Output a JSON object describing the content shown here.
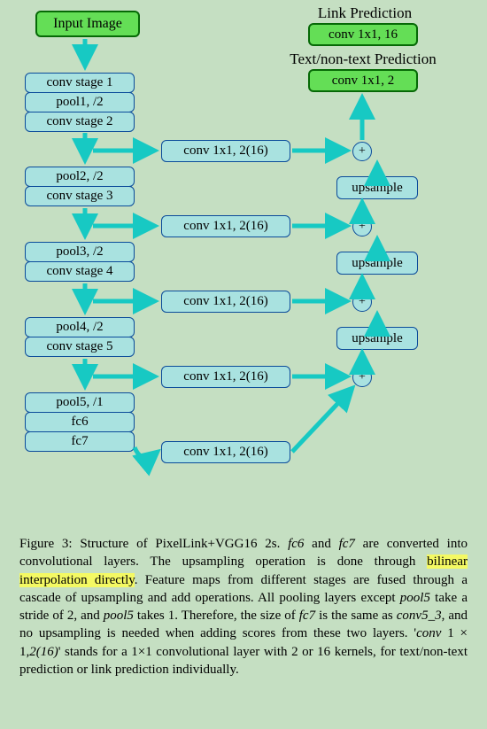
{
  "input": "Input Image",
  "head": {
    "link_title": "Link Prediction",
    "text_title": "Text/non-text Prediction",
    "link_box": "conv 1x1, 16",
    "text_box": "conv 1x1, 2"
  },
  "left": {
    "s12": [
      "conv stage 1",
      "pool1, /2",
      "conv stage 2"
    ],
    "s3": [
      "pool2, /2",
      "conv stage 3"
    ],
    "s4": [
      "pool3, /2",
      "conv stage 4"
    ],
    "s5": [
      "pool4, /2",
      "conv stage 5"
    ],
    "s6": [
      "pool5, /1",
      "fc6",
      "fc7"
    ]
  },
  "mid": {
    "c": "conv 1x1, 2(16)"
  },
  "right": {
    "up": "upsample",
    "plus": "+"
  },
  "caption": {
    "lead": "Figure 3: Structure of PixelLink+VGG16 2s. ",
    "fc6": "fc6",
    "and": " and ",
    "fc7": "fc7",
    "t1": " are converted into convolutional layers. The upsampling operation is done through ",
    "hl": "bilinear interpolation directly",
    "t2": ". Feature maps from different stages are fused through a cascade of upsampling and add operations. All pooling layers except ",
    "p5": "pool5",
    "t3": " take a stride of 2, and ",
    "p5b": "pool5",
    "t4": " takes 1. Therefore, the size of ",
    "fc7b": "fc7",
    "t5": " is the same as ",
    "c53": "conv5_3",
    "t6": ", and no upsampling is needed when adding scores from these two layers. '",
    "conv": "conv",
    "t7": " 1 × 1",
    "two16": ",2(16)",
    "t8": "' stands for a 1×1 convolutional layer with 2 or 16 kernels, for text/non-text prediction or link prediction individually."
  }
}
